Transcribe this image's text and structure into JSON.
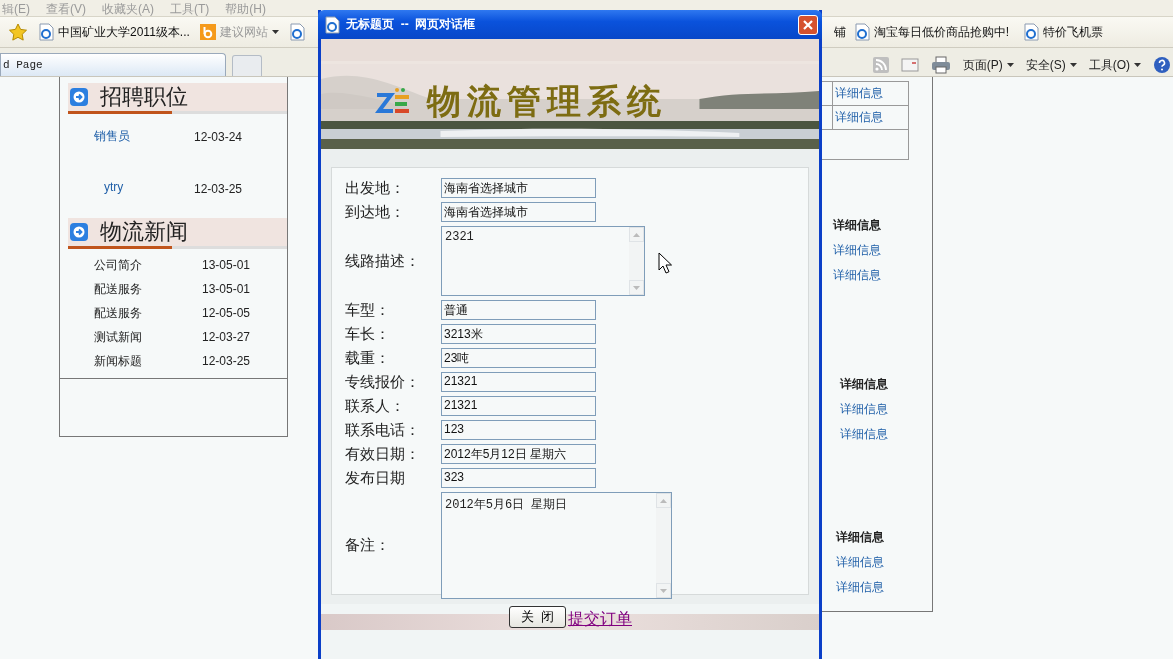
{
  "browser": {
    "menu": [
      "辑(E)",
      "查看(V)",
      "收藏夹(A)",
      "工具(T)",
      "帮助(H)"
    ],
    "favorites": [
      {
        "label": "中国矿业大学2011级本...",
        "kind": "page"
      },
      {
        "label": "建议网站",
        "kind": "suggested"
      },
      {
        "kind": "icon_only"
      }
    ],
    "favorites_right": [
      {
        "label": "铺",
        "kind": "cut"
      },
      {
        "label": "淘宝每日低价商品抢购中!",
        "kind": "page"
      },
      {
        "label": "特价飞机票",
        "kind": "page"
      }
    ],
    "tab": {
      "title": "d Page"
    },
    "commands": [
      "页面(P)",
      "安全(S)",
      "工具(O)"
    ]
  },
  "left": {
    "sections": [
      {
        "title": "招聘职位",
        "kind": "jobs",
        "items": [
          {
            "name": "销售员",
            "date": "12-03-24"
          },
          {
            "name": "ytry",
            "date": "12-03-25"
          }
        ]
      },
      {
        "title": "物流新闻",
        "kind": "news",
        "items": [
          {
            "name": "公司简介",
            "date": "13-05-01"
          },
          {
            "name": "配送服务",
            "date": "13-05-01"
          },
          {
            "name": "配送服务",
            "date": "12-05-05"
          },
          {
            "name": "测试新闻",
            "date": "12-03-27"
          },
          {
            "name": "新闻标题",
            "date": "12-03-25"
          }
        ]
      }
    ]
  },
  "right": {
    "top_links": [
      "详细信息",
      "详细信息"
    ],
    "groups": [
      {
        "heading": "详细信息",
        "links": [
          "详细信息",
          "详细信息"
        ]
      },
      {
        "heading": "详细信息",
        "links": [
          "详细信息",
          "详细信息"
        ]
      },
      {
        "heading": "详细信息",
        "links": [
          "详细信息",
          "详细信息"
        ]
      }
    ]
  },
  "dialog": {
    "title": "无标题页  --  网页对话框",
    "banner_title": "物流管理系统",
    "fields": [
      {
        "label": "出发地：",
        "value": "海南省选择城市",
        "kind": "input"
      },
      {
        "label": "到达地：",
        "value": "海南省选择城市",
        "kind": "input"
      },
      {
        "label": "线路描述：",
        "value": "2321",
        "kind": "textarea"
      },
      {
        "label": "车型：",
        "value": "普通",
        "kind": "input"
      },
      {
        "label": "车长：",
        "value": "3213米",
        "kind": "input"
      },
      {
        "label": "载重：",
        "value": "23吨",
        "kind": "input"
      },
      {
        "label": "专线报价：",
        "value": "21321",
        "kind": "input"
      },
      {
        "label": "联系人：",
        "value": "21321",
        "kind": "input"
      },
      {
        "label": "联系电话：",
        "value": "123",
        "kind": "input"
      },
      {
        "label": "有效日期：",
        "value": "2012年5月12日  星期六",
        "kind": "input"
      },
      {
        "label": "发布日期",
        "value": "323",
        "kind": "input"
      },
      {
        "label": "备注：",
        "value": "2012年5月6日  星期日",
        "kind": "memo"
      }
    ],
    "close_button": "关  闭",
    "submit_link": "提交订单"
  }
}
